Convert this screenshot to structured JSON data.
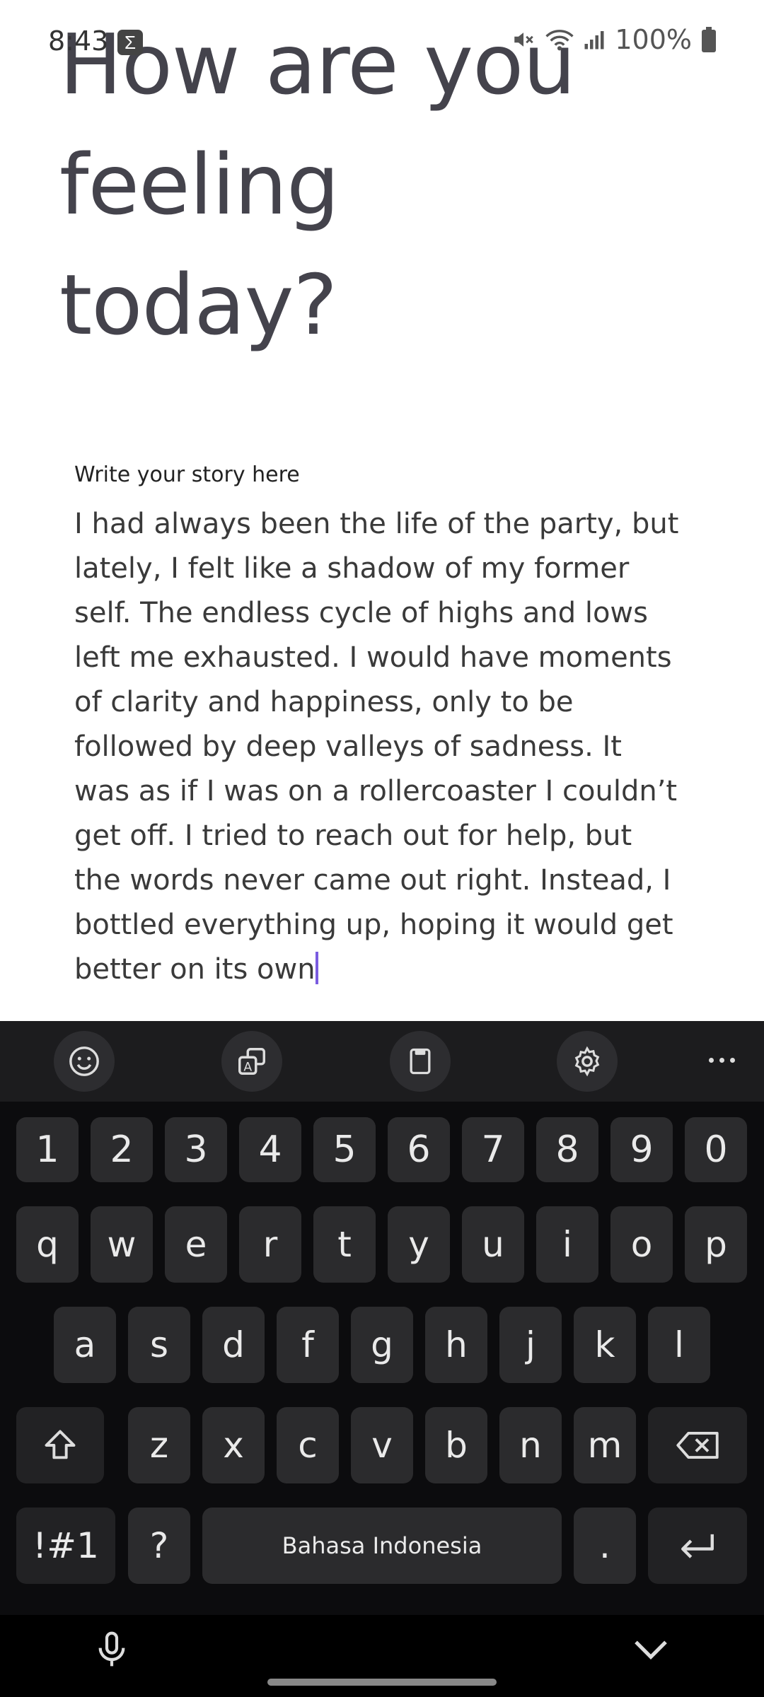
{
  "status": {
    "time": "8:43",
    "notif_icon": "sigma",
    "battery": "100%"
  },
  "title": "How are you feeling today?",
  "story_label": "Write your story here",
  "story_text": "I had always been the life of the party, but lately, I felt like a shadow of my former self. The endless cycle of highs and lows left me exhausted. I would have moments of clarity and happiness, only to be followed by deep valleys of sadness. It was as if I was on a rollercoaster I couldn’t get off. I tried to reach out for help, but the words never came out right. Instead, I bottled everything up, hoping it would get better on its own",
  "keyboard": {
    "toolbar_icons": [
      "emoji-icon",
      "translate-icon",
      "clipboard-icon",
      "settings-icon",
      "more-icon"
    ],
    "row_numbers": [
      "1",
      "2",
      "3",
      "4",
      "5",
      "6",
      "7",
      "8",
      "9",
      "0"
    ],
    "row1": [
      "q",
      "w",
      "e",
      "r",
      "t",
      "y",
      "u",
      "i",
      "o",
      "p"
    ],
    "row2": [
      "a",
      "s",
      "d",
      "f",
      "g",
      "h",
      "j",
      "k",
      "l"
    ],
    "row3": [
      "z",
      "x",
      "c",
      "v",
      "b",
      "n",
      "m"
    ],
    "symbols_label": "!#1",
    "question_label": "?",
    "space_label": "Bahasa Indonesia",
    "period_label": "."
  }
}
